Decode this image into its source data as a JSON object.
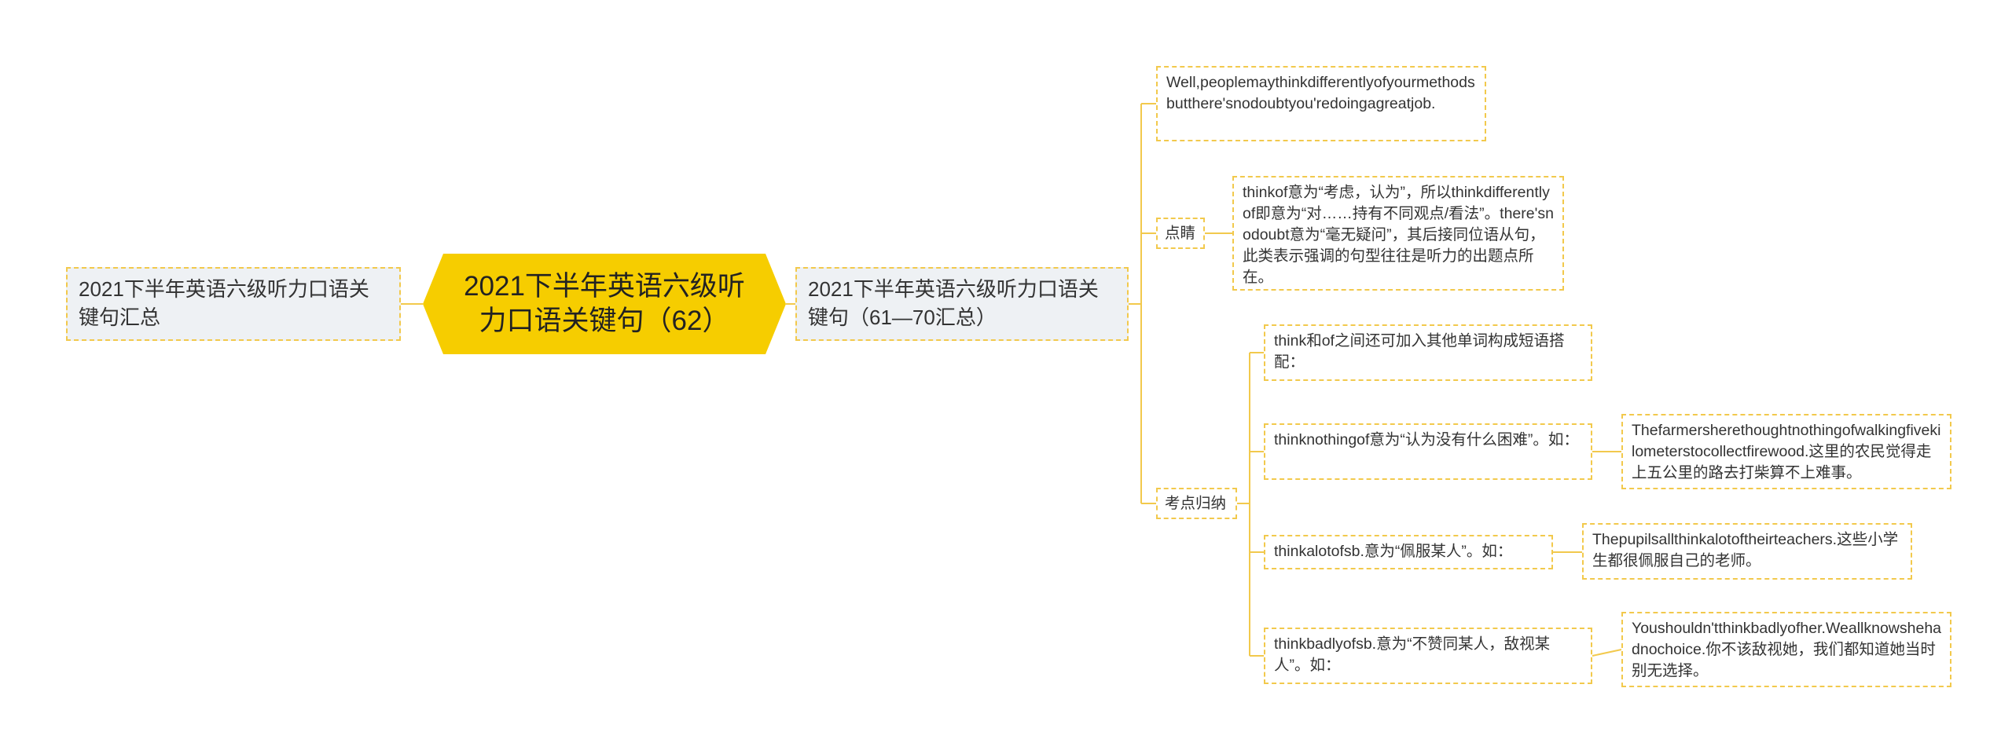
{
  "root": {
    "label": "2021下半年英语六级听力口语关键句（62）"
  },
  "left": {
    "label": "2021下半年英语六级听力口语关键句汇总"
  },
  "right": {
    "label": "2021下半年英语六级听力口语关键句（61—70汇总）"
  },
  "top_note": {
    "label": "Well,peoplemaythinkdifferentlyofyourmethodsbutthere'snodoubtyou'redoingagreatjob."
  },
  "dianjing": {
    "tag": "点睛",
    "note": "thinkof意为“考虑，认为”，所以thinkdifferentlyof即意为“对……持有不同观点/看法”。there'snodoubt意为“毫无疑问”，其后接同位语从句，此类表示强调的句型往往是听力的出题点所在。"
  },
  "kaodian": {
    "tag": "考点归纳",
    "items": [
      {
        "label": "think和of之间还可加入其他单词构成短语搭配：",
        "example": ""
      },
      {
        "label": "thinknothingof意为“认为没有什么困难”。如：",
        "example": "Thefarmersherethoughtnothingofwalkingfivekilometerstocollectfirewood.这里的农民觉得走上五公里的路去打柴算不上难事。"
      },
      {
        "label": "thinkalotofsb.意为“佩服某人”。如：",
        "example": "Thepupilsallthinkalotoftheirteachers.这些小学生都很佩服自己的老师。"
      },
      {
        "label": "thinkbadlyofsb.意为“不赞同某人，敌视某人”。如：",
        "example": "Youshouldn'tthinkbadlyofher.Weallknowshehadnochoice.你不该敌视她，我们都知道她当时别无选择。"
      }
    ]
  },
  "colors": {
    "root_fill": "#f6cd00",
    "node_border": "#f2c94c",
    "side_fill": "#eef1f4",
    "connector": "#f2c94c"
  }
}
